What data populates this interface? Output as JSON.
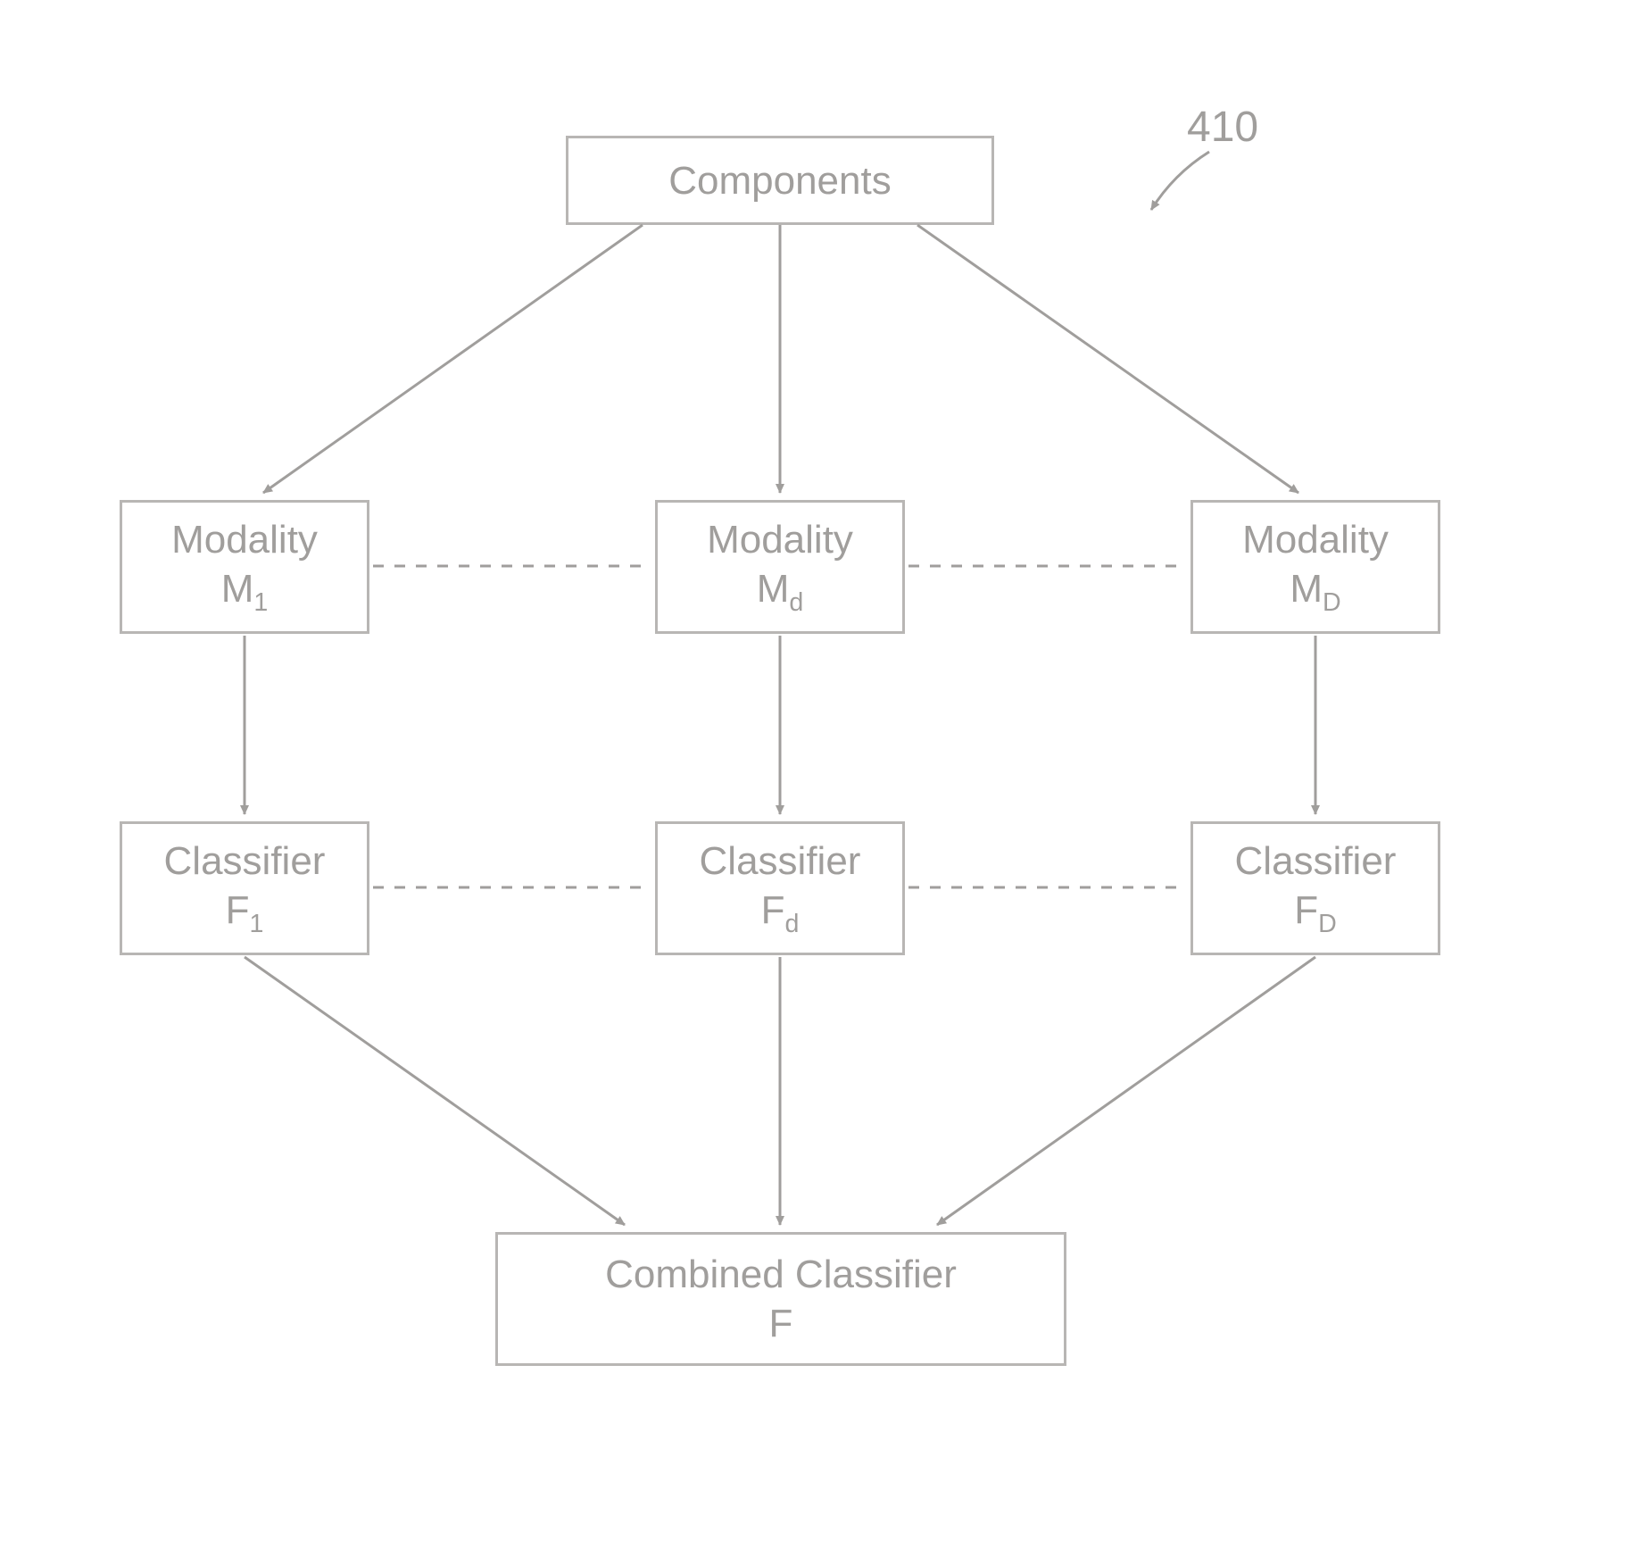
{
  "refLabel": "410",
  "nodes": {
    "components": {
      "line1": "Components"
    },
    "modality1": {
      "line1": "Modality",
      "line2_main": "M",
      "line2_sub": "1"
    },
    "modalityd": {
      "line1": "Modality",
      "line2_main": "M",
      "line2_sub": "d"
    },
    "modalityD": {
      "line1": "Modality",
      "line2_main": "M",
      "line2_sub": "D"
    },
    "classifier1": {
      "line1": "Classifier",
      "line2_main": "F",
      "line2_sub": "1"
    },
    "classifierd": {
      "line1": "Classifier",
      "line2_main": "F",
      "line2_sub": "d"
    },
    "classifierD": {
      "line1": "Classifier",
      "line2_main": "F",
      "line2_sub": "D"
    },
    "combined": {
      "line1": "Combined Classifier",
      "line2": "F"
    }
  }
}
